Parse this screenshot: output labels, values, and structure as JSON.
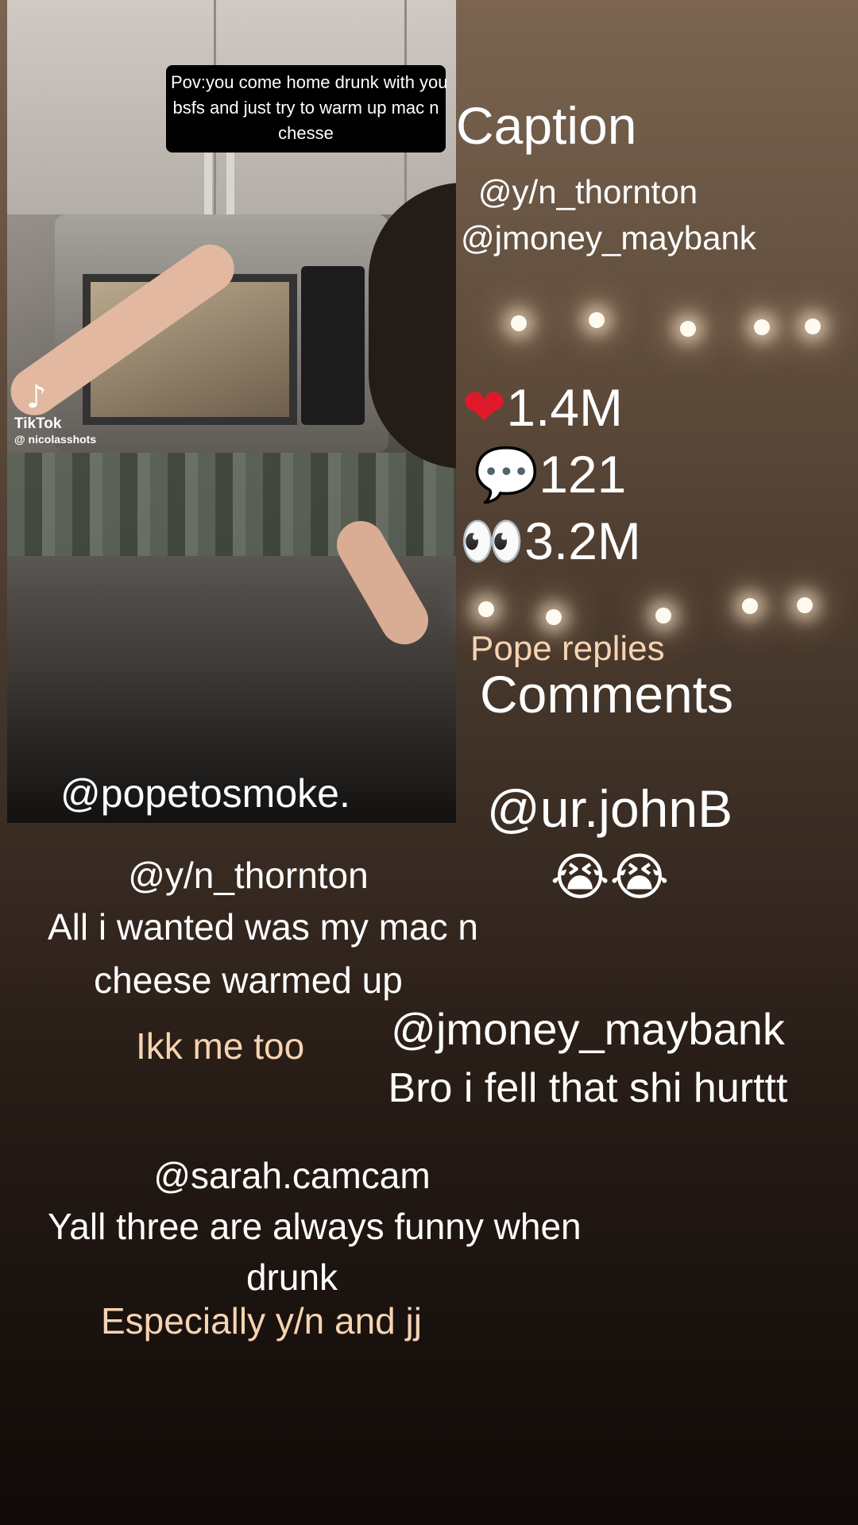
{
  "video": {
    "overlay_caption": [
      "Pov:you come home drunk with you",
      "bsfs and just try to warm up mac n",
      "chesse"
    ],
    "watermark_brand": "TikTok",
    "watermark_handle": "@ nicolasshots",
    "poster": "@popetosmoke."
  },
  "caption_section": {
    "title": "Caption",
    "tags": [
      "@y/n_thornton",
      "@jmoney_maybank"
    ]
  },
  "stats": {
    "likes_icon": "heart-icon",
    "likes": "1.4M",
    "comments_icon": "speech-bubble-icon",
    "comments": "121",
    "views_icon": "eyes-icon",
    "views": "3.2M"
  },
  "comments_section": {
    "pope_replies_label": "Pope replies",
    "title": "Comments",
    "items": [
      {
        "user": "@ur.johnB",
        "text": "😭😭"
      },
      {
        "user": "@y/n_thornton",
        "text_lines": [
          "All i wanted was my mac n",
          "cheese warmed up"
        ],
        "reply": "Ikk me too"
      },
      {
        "user": "@jmoney_maybank",
        "text": "Bro i fell that shi hurttt"
      },
      {
        "user": "@sarah.camcam",
        "text_lines": [
          "Yall three are always funny when",
          "drunk"
        ],
        "reply": "Especially y/n and jj"
      }
    ]
  },
  "colors": {
    "reply_color": "#f6d3b1",
    "heart_color": "#e0192a"
  }
}
